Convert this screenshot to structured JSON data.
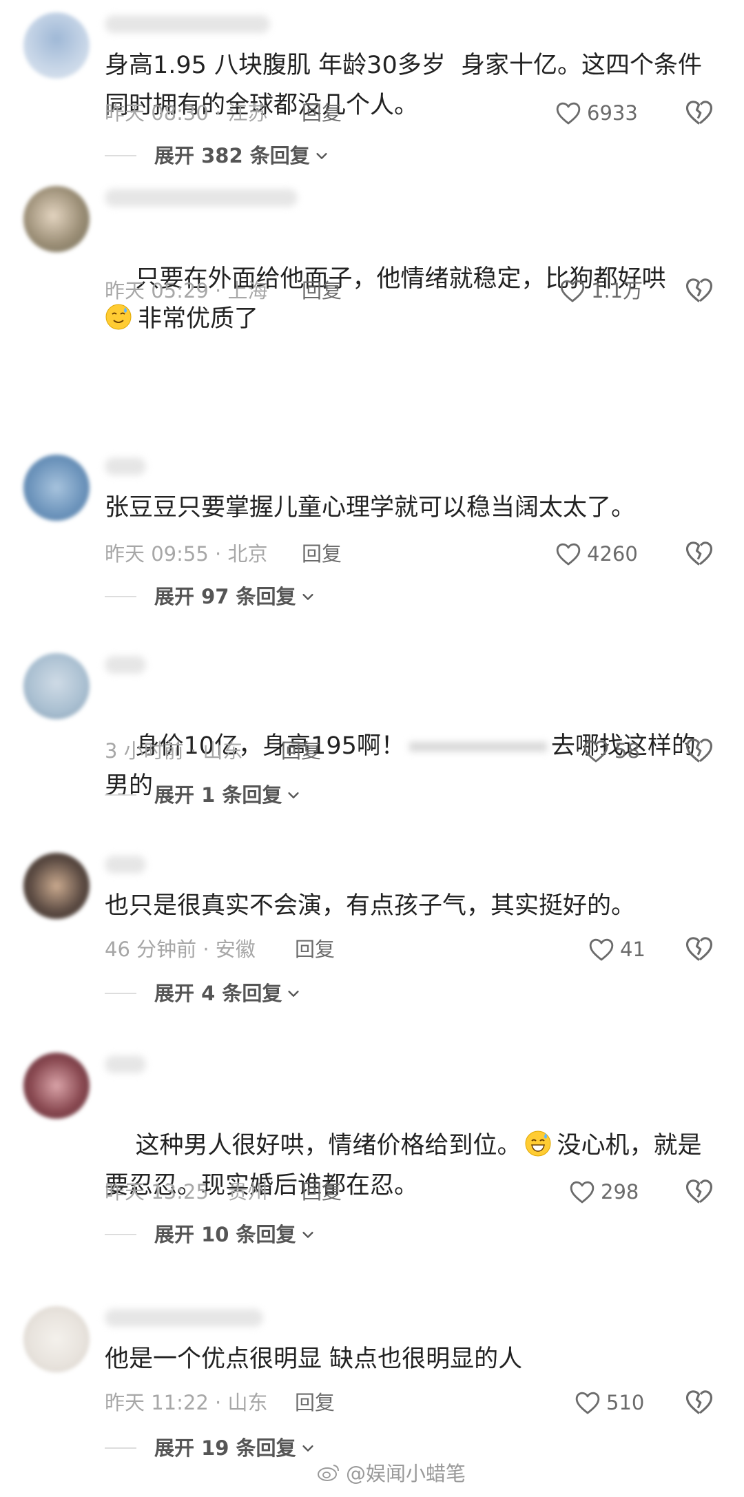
{
  "comments": [
    {
      "text": "身高1.95 八块腹肌 年龄30多岁  身家十亿。这四个条件同时拥有的全球都没几个人。",
      "time": "昨天 08:30",
      "location": "江苏",
      "reply_label": "回复",
      "likes": "6933",
      "expand_label": "展开 382 条回复",
      "avatar_color": "#c9d7e8"
    },
    {
      "text": "只要在外面给他面子，他情绪就稳定，比狗都好哄",
      "text2": "非常优质了",
      "emoji": "sweat-smile-emoji",
      "time": "昨天 05:29",
      "location": "上海",
      "reply_label": "回复",
      "likes": "1.1万",
      "avatar_color": "#9c8f77"
    },
    {
      "text": "张豆豆只要掌握儿童心理学就可以稳当阔太太了。",
      "time": "昨天 09:55",
      "location": "北京",
      "reply_label": "回复",
      "likes": "4260",
      "expand_label": "展开 97 条回复",
      "avatar_color": "#6f96bd"
    },
    {
      "text_before": "身价10亿，身高195啊！",
      "text_after": "去哪找这样的男的",
      "time": "3 小时前",
      "location": "山东",
      "reply_label": "回复",
      "likes": "58",
      "expand_label": "展开 1 条回复",
      "avatar_color": "#a8bed0"
    },
    {
      "text": "也只是很真实不会演，有点孩子气，其实挺好的。",
      "time": "46 分钟前",
      "location": "安徽",
      "reply_label": "回复",
      "likes": "41",
      "expand_label": "展开 4 条回复",
      "avatar_color": "#5f4e45"
    },
    {
      "text": "这种男人很好哄，情绪价格给到位。",
      "emoji": "grinning-sweat-emoji",
      "text_after_emoji": "没心机，就是要忍忍。现实婚后谁都在忍。",
      "time": "昨天 13:25",
      "location": "贵州",
      "reply_label": "回复",
      "likes": "298",
      "expand_label": "展开 10 条回复",
      "avatar_color": "#8a4a52"
    },
    {
      "text": "他是一个优点很明显 缺点也很明显的人",
      "time": "昨天 11:22",
      "location": "山东",
      "reply_label": "回复",
      "likes": "510",
      "expand_label": "展开 19 条回复",
      "avatar_color": "#e7e2dc"
    }
  ],
  "watermark": "@娱闻小蜡笔",
  "icons": [
    "heart-outline-icon",
    "broken-heart-icon",
    "chevron-down-icon",
    "weibo-icon"
  ]
}
